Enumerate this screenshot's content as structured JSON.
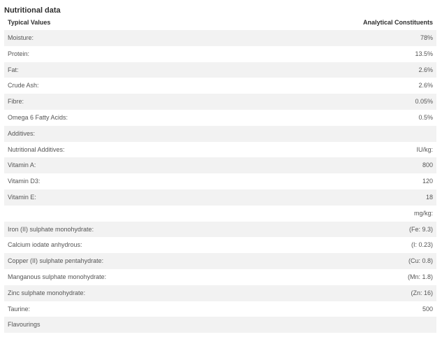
{
  "title": "Nutritional data",
  "columns": [
    "Typical Values",
    "Analytical Constituents"
  ],
  "rows": [
    {
      "label": "Moisture:",
      "value": "78%"
    },
    {
      "label": "Protein:",
      "value": "13.5%"
    },
    {
      "label": "Fat:",
      "value": "2.6%"
    },
    {
      "label": "Crude Ash:",
      "value": "2.6%"
    },
    {
      "label": "Fibre:",
      "value": "0.05%"
    },
    {
      "label": "Omega 6 Fatty Acids:",
      "value": "0.5%"
    },
    {
      "label": "Additives:",
      "value": ""
    },
    {
      "label": "Nutritional Additives:",
      "value": "IU/kg:"
    },
    {
      "label": "Vitamin A:",
      "value": "800"
    },
    {
      "label": "Vitamin D3:",
      "value": "120"
    },
    {
      "label": "Vitamin E:",
      "value": "18"
    },
    {
      "label": "",
      "value": "mg/kg:"
    },
    {
      "label": "Iron (II) sulphate monohydrate:",
      "value": "(Fe: 9.3)"
    },
    {
      "label": "Calcium iodate anhydrous:",
      "value": "(I: 0.23)"
    },
    {
      "label": "Copper (II) sulphate pentahydrate:",
      "value": "(Cu: 0.8)"
    },
    {
      "label": "Manganous sulphate monohydrate:",
      "value": "(Mn: 1.8)"
    },
    {
      "label": "Zinc sulphate monohydrate:",
      "value": "(Zn: 16)"
    },
    {
      "label": "Taurine:",
      "value": "500"
    },
    {
      "label": "Flavourings",
      "value": ""
    }
  ]
}
